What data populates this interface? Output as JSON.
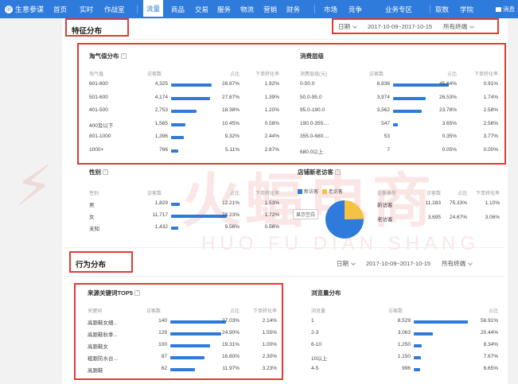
{
  "nav": {
    "app_name": "生意参谋",
    "items": [
      "首页",
      "实时",
      "作战室",
      "流量",
      "商品",
      "交易",
      "服务",
      "物流",
      "营销",
      "财务"
    ],
    "right_items": [
      "市场",
      "竞争",
      "业务专区"
    ],
    "far_right": [
      "取数",
      "学院"
    ],
    "message": "消息"
  },
  "section1": {
    "title": "特征分布",
    "filter": {
      "period_label": "日期",
      "date_range": "2017-10-09~2017-10-15",
      "terminal": "所有终端"
    }
  },
  "taoqi": {
    "title": "淘气值分布",
    "headers": [
      "淘气值",
      "访客数",
      "占比",
      "下单转化率"
    ],
    "rows": [
      {
        "label": "601-800",
        "visitors": "4,325",
        "share": "28.87%",
        "conv": "1.92%",
        "bar": 0.633
      },
      {
        "label": "501-600",
        "visitors": "4,174",
        "share": "27.87%",
        "conv": "1.39%",
        "bar": 0.611
      },
      {
        "label": "401-500",
        "visitors": "2,753",
        "share": "18.38%",
        "conv": "1.20%",
        "bar": 0.403
      },
      {
        "label": "400及以下",
        "visitors": "1,565",
        "share": "10.45%",
        "conv": "0.58%",
        "bar": 0.229
      },
      {
        "label": "801-1000",
        "visitors": "1,396",
        "share": "9.32%",
        "conv": "2.44%",
        "bar": 0.204
      },
      {
        "label": "1000+",
        "visitors": "766",
        "share": "5.11%",
        "conv": "2.87%",
        "bar": 0.112
      }
    ]
  },
  "consume": {
    "title": "消费层级",
    "headers": [
      "消费层级(元)",
      "访客数",
      "占比",
      "下单转化率"
    ],
    "rows": [
      {
        "label": "0-50.0",
        "visitors": "6,836",
        "share": "45.64%",
        "conv": "0.91%",
        "bar": 1.0
      },
      {
        "label": "50.0-95.0",
        "visitors": "3,974",
        "share": "26.53%",
        "conv": "1.74%",
        "bar": 0.581
      },
      {
        "label": "95.0-190.0",
        "visitors": "3,562",
        "share": "23.78%",
        "conv": "2.58%",
        "bar": 0.521
      },
      {
        "label": "190.0-355....",
        "visitors": "547",
        "share": "3.65%",
        "conv": "2.56%",
        "bar": 0.08
      },
      {
        "label": "355.0-680....",
        "visitors": "53",
        "share": "0.35%",
        "conv": "3.77%",
        "bar": 0
      },
      {
        "label": "680.0以上",
        "visitors": "7",
        "share": "0.05%",
        "conv": "0.00%",
        "bar": 0
      }
    ]
  },
  "gender": {
    "title": "性别",
    "headers": [
      "性别",
      "访客数",
      "占比",
      "下单转化率"
    ],
    "rows": [
      {
        "label": "男",
        "visitors": "1,829",
        "share": "12.21%",
        "conv": "1.53%",
        "bar": 0.156
      },
      {
        "label": "女",
        "visitors": "11,717",
        "share": "78.23%",
        "conv": "1.72%",
        "bar": 1.0
      },
      {
        "label": "未知",
        "visitors": "1,432",
        "share": "9.56%",
        "conv": "0.56%",
        "bar": 0.122
      }
    ]
  },
  "newold": {
    "title": "店铺新老访客",
    "legend": [
      "新访客",
      "老访客"
    ],
    "show_btn": "显示空白",
    "headers": [
      "访客类型",
      "访客数",
      "占比",
      "下单转化率"
    ],
    "rows": [
      {
        "label": "新访客",
        "visitors": "11,283",
        "share": "75.33%",
        "conv": "1.10%"
      },
      {
        "label": "老访客",
        "visitors": "3,695",
        "share": "24.67%",
        "conv": "3.06%"
      }
    ],
    "colors": {
      "new": "#2e7bdb",
      "old": "#f5c242"
    },
    "new_share": 0.7533
  },
  "section2": {
    "title": "行为分布",
    "filter": {
      "period_label": "日期",
      "date_range": "2017-10-09~2017-10-15",
      "terminal": "所有终端"
    }
  },
  "keywords": {
    "title": "来源关键词TOP5",
    "headers": [
      "关键词",
      "访客数",
      "占比",
      "下单转化率"
    ],
    "rows": [
      {
        "label": "高跟鞋女细...",
        "visitors": "140",
        "share": "27.03%",
        "conv": "2.14%",
        "bar": 1.0
      },
      {
        "label": "高跟鞋秋季...",
        "visitors": "129",
        "share": "24.90%",
        "conv": "1.55%",
        "bar": 0.921
      },
      {
        "label": "高跟鞋女",
        "visitors": "100",
        "share": "19.31%",
        "conv": "1.00%",
        "bar": 0.714
      },
      {
        "label": "粗跟防水台...",
        "visitors": "87",
        "share": "16.80%",
        "conv": "2.30%",
        "bar": 0.621
      },
      {
        "label": "高跟鞋",
        "visitors": "62",
        "share": "11.97%",
        "conv": "3.23%",
        "bar": 0.443
      }
    ]
  },
  "browse": {
    "title": "浏览量分布",
    "headers": [
      "浏览量",
      "访客数",
      "占比"
    ],
    "rows": [
      {
        "label": "1",
        "visitors": "8,529",
        "share": "56.91%",
        "bar": 1.0
      },
      {
        "label": "2-3",
        "visitors": "3,063",
        "share": "20.44%",
        "bar": 0.359
      },
      {
        "label": "6-10",
        "visitors": "1,250",
        "share": "8.34%",
        "bar": 0.147
      },
      {
        "label": "10以上",
        "visitors": "1,150",
        "share": "7.67%",
        "bar": 0.135
      },
      {
        "label": "4-5",
        "visitors": "996",
        "share": "6.65%",
        "bar": 0.117
      }
    ]
  },
  "watermark": {
    "cn": "火蝠电商",
    "en": "HUO FU DIAN SHANG"
  }
}
